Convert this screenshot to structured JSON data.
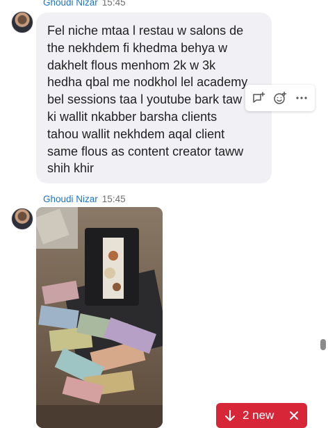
{
  "messages": [
    {
      "sender": "Ghoudi Nizar",
      "time": "15:45",
      "text": "Fel niche mtaa l restau w salons de\nthe nekhdem fi khedma behya w\ndakhelt flous menhom 2k w 3k\nhedha qbal me nodkhol lel academy\nbel sessions taa l youtube bark  taw\nki wallit nkabber  barsha clients\ntahou wallit nekhdem aqal client\nsame flous as content creator  taww\nshih khir"
    },
    {
      "sender": "Ghoudi Nizar",
      "time": "15:45",
      "attachment": "photo"
    }
  ],
  "toolbar": {
    "icons": [
      "reply-icon",
      "react-icon",
      "more-icon"
    ]
  },
  "new_messages": {
    "label": "2 new"
  },
  "colors": {
    "sender": "#1b73c8",
    "bubble": "#f1f1f5",
    "new_pill": "#d72638"
  }
}
